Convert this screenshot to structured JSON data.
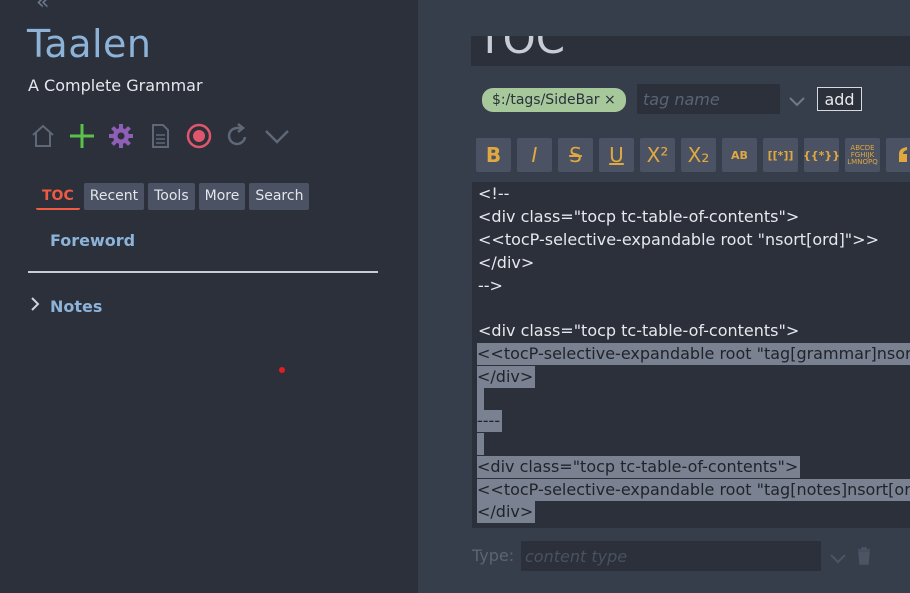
{
  "sidebar": {
    "title": "Taalen",
    "subtitle": "A Complete Grammar",
    "tabs": [
      {
        "label": "TOC"
      },
      {
        "label": "Recent"
      },
      {
        "label": "Tools"
      },
      {
        "label": "More"
      },
      {
        "label": "Search"
      }
    ],
    "toc_items": [
      "Foreword",
      "Notes"
    ],
    "icons": [
      "home-icon",
      "plus-icon",
      "gear-icon",
      "document-icon",
      "record-icon",
      "refresh-icon",
      "chevron-down-icon"
    ]
  },
  "editor": {
    "title": "TOC",
    "tag": "$:/tags/SideBar",
    "tag_remove": "×",
    "tag_placeholder": "tag name",
    "add_label": "add",
    "toolbar": [
      "B",
      "I",
      "S",
      "U",
      "X²",
      "X₂",
      "AB",
      "[[*]]",
      "{{*}}",
      "ABCDE FGHIJK LMNOPQ"
    ],
    "code_lines": [
      "<!--",
      "<div class=\"tocp tc-table-of-contents\">",
      "<<tocP-selective-expandable root \"nsort[ord]\">>",
      "</div>",
      "-->",
      "",
      "<div class=\"tocp tc-table-of-contents\">",
      "<<tocP-selective-expandable root \"tag[grammar]nsort[ord]\">>",
      "</div>",
      "",
      "----",
      "",
      "<div class=\"tocp tc-table-of-contents\">",
      "<<tocP-selective-expandable root \"tag[notes]nsort[ord]\">>",
      "</div>"
    ],
    "type_label": "Type:",
    "type_placeholder": "content type"
  },
  "colors": {
    "sidebar_bg": "#2b303b",
    "main_bg": "#363d4b",
    "link": "#8db3d9",
    "active_tab": "#f05a42",
    "tag_pill": "#a6c89a",
    "toolbar_icon": "#e0a940",
    "selection": "#7a8190"
  }
}
